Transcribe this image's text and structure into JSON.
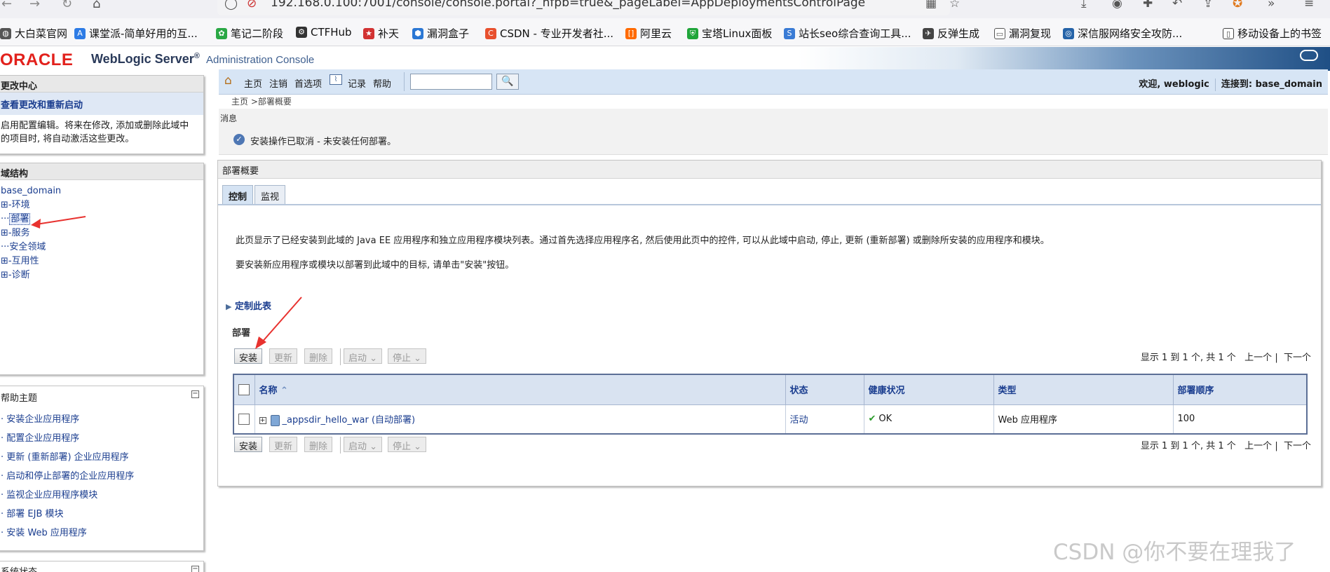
{
  "browser": {
    "url": "192.168.0.100:7001/console/console.portal?_nfpb=true&_pageLabel=AppDeploymentsControlPage",
    "bookmarks": [
      {
        "label": "大白菜官网",
        "icon": "globe-icon",
        "color": "#444444"
      },
      {
        "label": "课堂派-简单好用的互...",
        "icon": "ketangpai-icon",
        "color": "#2d7be5"
      },
      {
        "label": "笔记二阶段",
        "icon": "leaf-icon",
        "color": "#2aa845"
      },
      {
        "label": "CTFHub",
        "icon": "ctfhub-icon",
        "color": "#333333"
      },
      {
        "label": "补天",
        "icon": "star-icon",
        "color": "#d23333"
      },
      {
        "label": "漏洞盒子",
        "icon": "hexagon-icon",
        "color": "#2a77d4"
      },
      {
        "label": "CSDN - 专业开发者社...",
        "icon": "csdn-icon",
        "color": "#e8502e"
      },
      {
        "label": "阿里云",
        "icon": "aliyun-icon",
        "color": "#ff6a00"
      },
      {
        "label": "宝塔Linux面板",
        "icon": "shield-icon",
        "color": "#20a53a"
      },
      {
        "label": "站长seo综合查询工具...",
        "icon": "seo-icon",
        "color": "#3a7bd5"
      },
      {
        "label": "反弹生成",
        "icon": "plane-icon",
        "color": "#444444"
      },
      {
        "label": "漏洞复现",
        "icon": "folder-icon",
        "color": "#555555"
      },
      {
        "label": "深信服网络安全攻防...",
        "icon": "sangfor-icon",
        "color": "#2563a8"
      },
      {
        "label": "移动设备上的书签",
        "icon": "mobile-icon",
        "color": "#444444"
      }
    ]
  },
  "header": {
    "oracle": "ORACLE",
    "product": "WebLogic Server",
    "registered": "®",
    "console": "Administration Console"
  },
  "change_center": {
    "title": "更改中心",
    "link": "查看更改和重新启动",
    "text_line1": "启用配置编辑。将来在修改, 添加或删除此域中",
    "text_line2": "的项目时, 将自动激活这些更改。"
  },
  "domain_structure": {
    "title": "域结构",
    "root": "base_domain",
    "items": [
      "环境",
      "部署",
      "服务",
      "安全领域",
      "互用性",
      "诊断"
    ],
    "selected": "部署"
  },
  "help_topics": {
    "title": "帮助主题",
    "items": [
      "安装企业应用程序",
      "配置企业应用程序",
      "更新 (重新部署) 企业应用程序",
      "启动和停止部署的企业应用程序",
      "监视企业应用程序模块",
      "部署 EJB 模块",
      "安装 Web 应用程序"
    ]
  },
  "system_status": {
    "title": "系统状态"
  },
  "toolbar": {
    "home": "主页",
    "logout": "注销",
    "preferences": "首选项",
    "record": "记录",
    "help": "帮助",
    "search_value": "",
    "welcome": "欢迎, weblogic",
    "connected": "连接到: base_domain"
  },
  "breadcrumb": "主页 >部署概要",
  "messages": {
    "label": "消息",
    "text": "安装操作已取消 - 未安装任何部署。"
  },
  "main": {
    "title": "部署概要",
    "tabs": [
      "控制",
      "监视"
    ],
    "active_tab": "控制",
    "desc1": "此页显示了已经安装到此域的 Java EE 应用程序和独立应用程序模块列表。通过首先选择应用程序名, 然后使用此页中的控件, 可以从此域中启动, 停止, 更新 (重新部署) 或删除所安装的应用程序和模块。",
    "desc2": "要安装新应用程序或模块以部署到此域中的目标, 请单击\"安装\"按钮。",
    "customize": "定制此表",
    "section": "部署",
    "buttons": {
      "install": "安装",
      "update": "更新",
      "delete": "删除",
      "start": "启动",
      "stop": "停止"
    },
    "pager": {
      "summary": "显示 1 到 1 个, 共 1 个",
      "prev": "上一个",
      "sep": "|",
      "next": "下一个"
    },
    "table": {
      "columns": [
        "名称",
        "状态",
        "健康状况",
        "类型",
        "部署顺序"
      ],
      "rows": [
        {
          "name": "_appsdir_hello_war (自动部署)",
          "state": "活动",
          "health": "OK",
          "type": "Web 应用程序",
          "order": "100"
        }
      ]
    }
  },
  "watermark": "CSDN @你不要在理我了",
  "colors": {
    "oracle_red": "#e2211c",
    "link_blue": "#1a3d8f",
    "toolbar_bg": "#d7e5f5",
    "table_header_bg": "#d9e3f1",
    "annotation_red": "#e8322f"
  }
}
